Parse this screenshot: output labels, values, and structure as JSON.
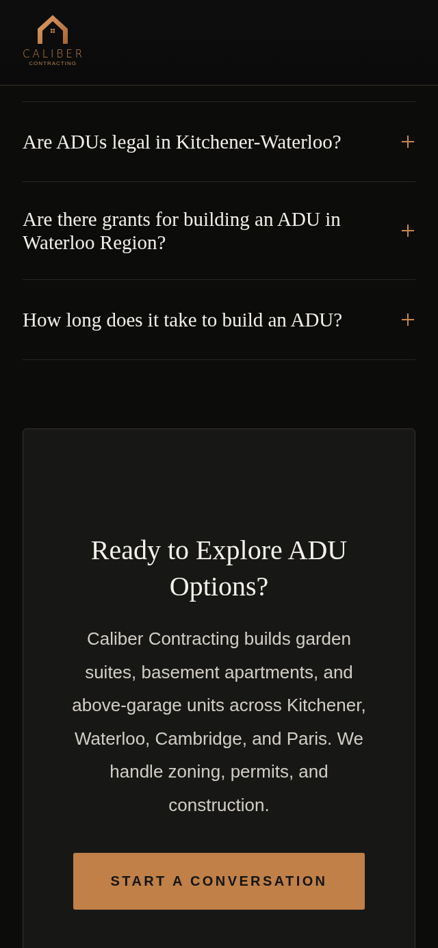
{
  "header": {
    "logo": {
      "name": "CALIBER",
      "tagline": "CONTRACTING"
    }
  },
  "faq": [
    {
      "question": "Are ADUs legal in Kitchener-Waterloo?",
      "expanded": false
    },
    {
      "question": "Are there grants for building an ADU in Waterloo Region?",
      "expanded": false
    },
    {
      "question": "How long does it take to build an ADU?",
      "expanded": false
    }
  ],
  "cta": {
    "title": "Ready to Explore ADU Options?",
    "body": "Caliber Contracting builds garden suites, basement apartments, and above-garage units across Kitchener, Waterloo, Cambridge, and Paris. We handle zoning, permits, and construction.",
    "button": "START A CONVERSATION"
  }
}
